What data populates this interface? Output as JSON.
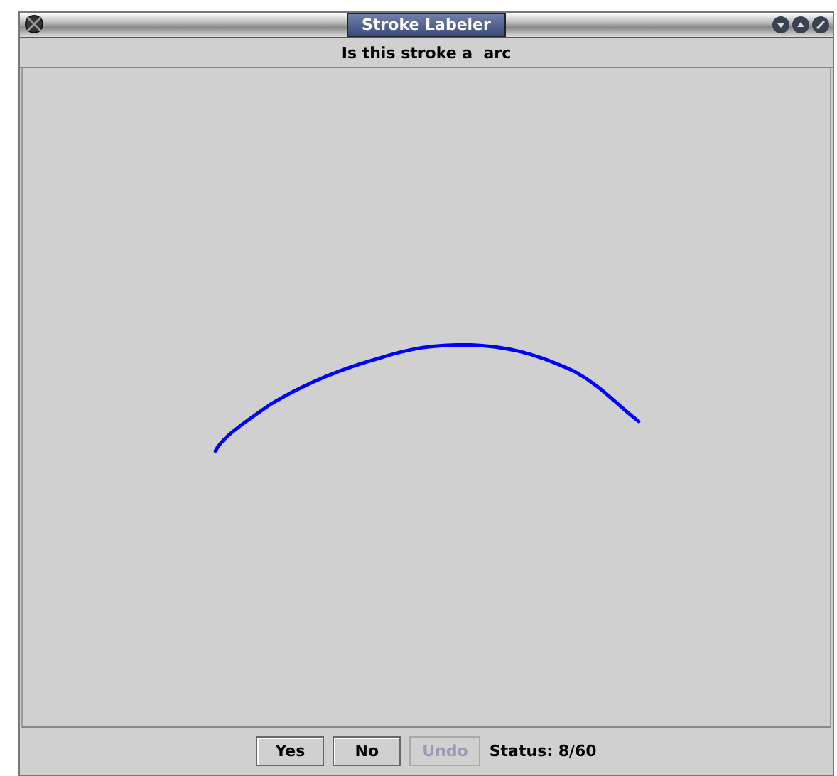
{
  "window": {
    "title": "Stroke Labeler"
  },
  "prompt": "Is this stroke a  arc",
  "buttons": [
    {
      "label": "Yes",
      "disabled": false
    },
    {
      "label": "No",
      "disabled": false
    },
    {
      "label": "Undo",
      "disabled": true
    }
  ],
  "status": "Status: 8/60"
}
